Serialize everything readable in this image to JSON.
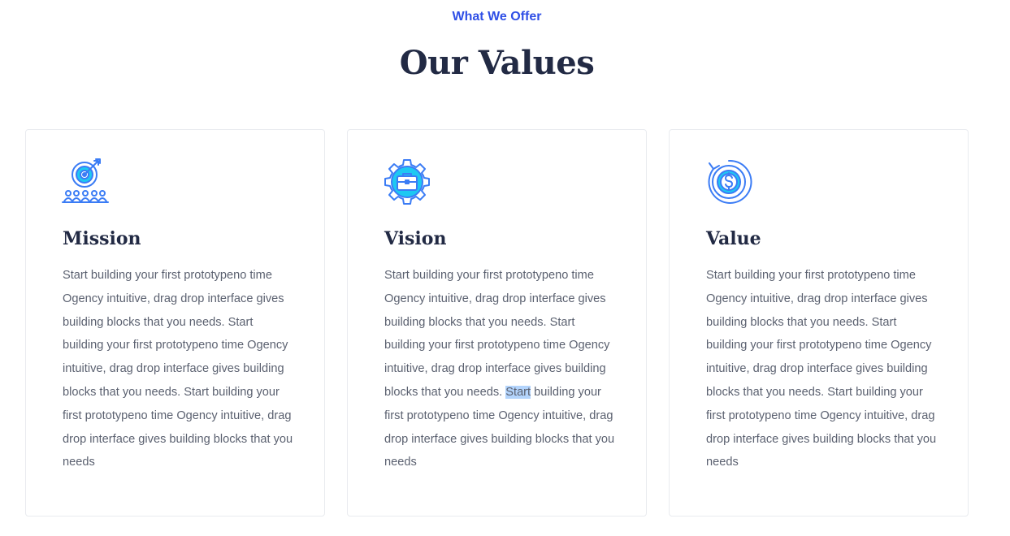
{
  "header": {
    "eyebrow": "What We Offer",
    "title": "Our Values"
  },
  "colors": {
    "accent": "#2f4fe6",
    "heading": "#222a44",
    "body_text": "#5b6170",
    "icon_primary": "#3b7cf5",
    "icon_secondary": "#1ec8f2",
    "card_border": "#e9ebef",
    "selection": "#b3d4fc"
  },
  "cards": [
    {
      "icon": "target-team-icon",
      "title": "Mission",
      "text": "Start building your first prototypeno time Ogency intuitive, drag drop interface gives building blocks that you needs. Start building your first prototypeno time Ogency intuitive, drag drop interface gives building blocks that you needs. Start building your first prototypeno time Ogency intuitive, drag drop interface gives building blocks that you needs"
    },
    {
      "icon": "gear-briefcase-icon",
      "title": "Vision",
      "text_before": "Start building your first prototypeno time Ogency intuitive, drag drop interface gives building blocks that you needs. Start building your first prototypeno time Ogency intuitive, drag drop interface gives building blocks that you needs. ",
      "text_highlight": "Start",
      "text_after": " building your first prototypeno time Ogency intuitive, drag drop interface gives building blocks that you needs"
    },
    {
      "icon": "dollar-cycle-icon",
      "title": "Value",
      "text": "Start building your first prototypeno time Ogency intuitive, drag drop interface gives building blocks that you needs. Start building your first prototypeno time Ogency intuitive, drag drop interface gives building blocks that you needs. Start building your first prototypeno time Ogency intuitive, drag drop interface gives building blocks that you needs"
    }
  ]
}
